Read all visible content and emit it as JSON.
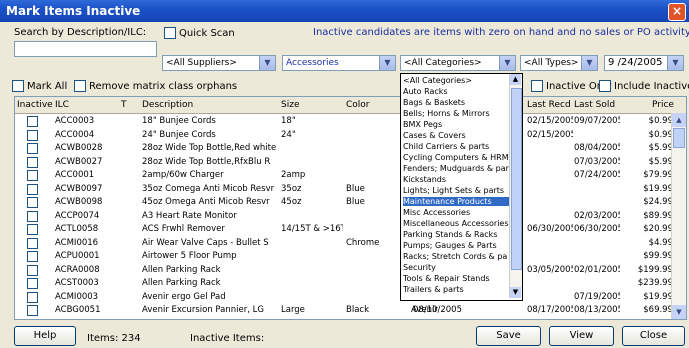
{
  "window": {
    "title": "Mark Items Inactive"
  },
  "search": {
    "label": "Search by Description/ILC:",
    "value": ""
  },
  "quick_scan": {
    "label": "Quick Scan",
    "checked": false
  },
  "info_text": "Inactive candidates are items with zero on hand and no sales or PO activity since:",
  "filters": {
    "supplier": "<All Suppliers>",
    "category_group": "Accessories",
    "category": "<All Categories>",
    "type": "<All Types>",
    "date": "9 /24/2005"
  },
  "options": {
    "mark_all": "Mark All",
    "remove_matrix": "Remove matrix class orphans",
    "inactive_only": "Inactive Only",
    "include_inactive": "Include Inactive"
  },
  "columns": {
    "inactive": "Inactive",
    "ilc": "ILC",
    "t": "T",
    "description": "Description",
    "size": "Size",
    "color": "Color",
    "last_recd": "Last Recd",
    "last_sold": "Last Sold",
    "price": "Price"
  },
  "rows": [
    {
      "ilc": "ACC0003",
      "desc": "18\" Bunjee Cords",
      "size": "18\"",
      "color": "",
      "brand": "",
      "c1": "",
      "recd": "02/15/2005",
      "sold": "09/07/2005",
      "price": "$0.99"
    },
    {
      "ilc": "ACC0004",
      "desc": "24\" Bunjee Cords",
      "size": "24\"",
      "color": "",
      "brand": "",
      "c1": "",
      "recd": "02/15/2005",
      "sold": "",
      "price": "$0.99"
    },
    {
      "ilc": "ACWB0028",
      "desc": "28oz Wide Top Bottle,Red white",
      "size": "",
      "color": "",
      "brand": "",
      "c1": "",
      "recd": "",
      "sold": "08/04/2005",
      "price": "$5.99"
    },
    {
      "ilc": "ACWB0027",
      "desc": "28oz Wide Top Bottle,RfxBlu R",
      "size": "",
      "color": "",
      "brand": "",
      "c1": "",
      "recd": "",
      "sold": "07/03/2005",
      "price": "$5.99"
    },
    {
      "ilc": "ACC0001",
      "desc": "2amp/60w Charger",
      "size": "2amp",
      "color": "",
      "brand": "",
      "c1": "",
      "recd": "",
      "sold": "07/24/2005",
      "price": "$79.99"
    },
    {
      "ilc": "ACWB0097",
      "desc": "35oz Comega Anti Micob Resvr",
      "size": "35oz",
      "color": "Blue",
      "brand": "",
      "c1": "",
      "recd": "",
      "sold": "",
      "price": "$19.99"
    },
    {
      "ilc": "ACWB0098",
      "desc": "45oz Omega Anti Micob Resvr",
      "size": "45oz",
      "color": "Blue",
      "brand": "",
      "c1": "",
      "recd": "",
      "sold": "",
      "price": "$24.99"
    },
    {
      "ilc": "ACCP0074",
      "desc": "A3 Heart Rate Monitor",
      "size": "",
      "color": "",
      "brand": "",
      "c1": "",
      "recd": "",
      "sold": "02/03/2005",
      "price": "$89.99"
    },
    {
      "ilc": "ACTL0058",
      "desc": "ACS Frwhl Remover",
      "size": "14/15T & >16T",
      "color": "",
      "brand": "",
      "c1": "",
      "recd": "06/30/2005",
      "sold": "06/30/2005",
      "price": "$20.99"
    },
    {
      "ilc": "ACMI0016",
      "desc": "Air Wear Valve Caps - Bullet S",
      "size": "",
      "color": "Chrome",
      "brand": "",
      "c1": "",
      "recd": "",
      "sold": "",
      "price": "$4.99"
    },
    {
      "ilc": "ACPU0001",
      "desc": "Airtower 5 Floor Pump",
      "size": "",
      "color": "",
      "brand": "",
      "c1": "",
      "recd": "",
      "sold": "",
      "price": "$99.99"
    },
    {
      "ilc": "ACRA0008",
      "desc": "Allen Parking Rack",
      "size": "",
      "color": "",
      "brand": "",
      "c1": "",
      "recd": "03/05/2005",
      "sold": "02/01/2005",
      "price": "$199.99"
    },
    {
      "ilc": "ACST0003",
      "desc": "Allen Parking Rack",
      "size": "",
      "color": "",
      "brand": "",
      "c1": "",
      "recd": "",
      "sold": "",
      "price": "$239.99"
    },
    {
      "ilc": "ACMI0003",
      "desc": "Avenir ergo Gel Pad",
      "size": "",
      "color": "",
      "brand": "",
      "c1": "",
      "recd": "",
      "sold": "07/19/2005",
      "price": "$19.99"
    },
    {
      "ilc": "ACBG0051",
      "desc": "Avenir Excursion Pannier, LG",
      "size": "Large",
      "color": "Black",
      "brand": "Avenir",
      "c1": "08/10/2005",
      "recd": "08/17/2005",
      "sold": "08/13/2005",
      "price": "$69.99"
    }
  ],
  "category_list": [
    "<All Categories>",
    "Auto Racks",
    "Bags & Baskets",
    "Bells; Horns & Mirrors",
    "BMX Pegs",
    "Cases & Covers",
    "Child Carriers & parts",
    "Cycling Computers & HRM",
    "Fenders; Mudguards & par",
    "Kickstands",
    "Lights; Light Sets & parts",
    "Maintenance Products",
    "Misc Accessories",
    "Miscellaneous Accessories",
    "Parking Stands & Racks",
    "Pumps; Gauges & Parts",
    "Racks; Stretch Cords & pa",
    "Security",
    "Tools & Repair Stands",
    "Trailers & parts"
  ],
  "selected_category": "Maintenance Products",
  "footer": {
    "help": "Help",
    "items_label": "Items: 234",
    "inactive_label": "Inactive Items:",
    "save": "Save",
    "view": "View",
    "close": "Close"
  }
}
